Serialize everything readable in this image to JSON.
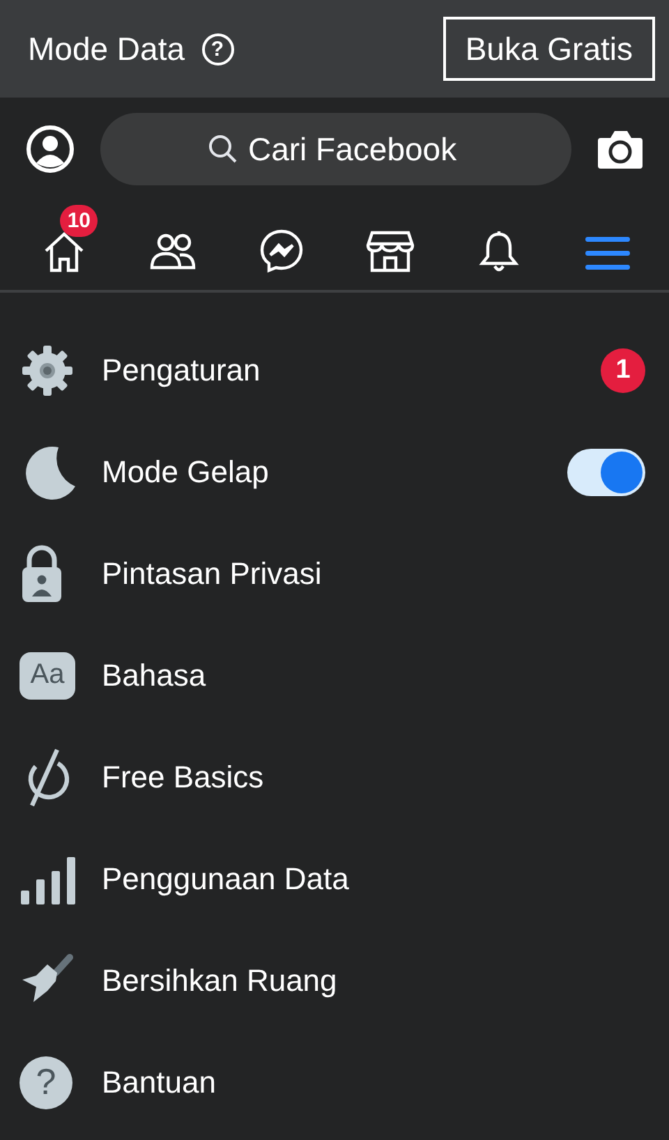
{
  "top_bar": {
    "title": "Mode Data",
    "help_glyph": "?",
    "button": "Buka Gratis"
  },
  "search": {
    "placeholder": "Cari Facebook"
  },
  "nav_tabs": [
    {
      "selected": false,
      "badge": "10"
    },
    {
      "selected": false
    },
    {
      "selected": false
    },
    {
      "selected": false
    },
    {
      "selected": false
    },
    {
      "selected": true
    }
  ],
  "menu": [
    {
      "label": "Pengaturan",
      "kind": "badge",
      "badge": "1"
    },
    {
      "label": "Mode Gelap",
      "kind": "toggle",
      "on": true
    },
    {
      "label": "Pintasan Privasi",
      "kind": "plain"
    },
    {
      "label": "Bahasa",
      "kind": "plain",
      "glyph": "Aa"
    },
    {
      "label": "Free Basics",
      "kind": "plain"
    },
    {
      "label": "Penggunaan Data",
      "kind": "plain"
    },
    {
      "label": "Bersihkan Ruang",
      "kind": "plain"
    },
    {
      "label": "Bantuan",
      "kind": "plain",
      "glyph": "?"
    }
  ]
}
